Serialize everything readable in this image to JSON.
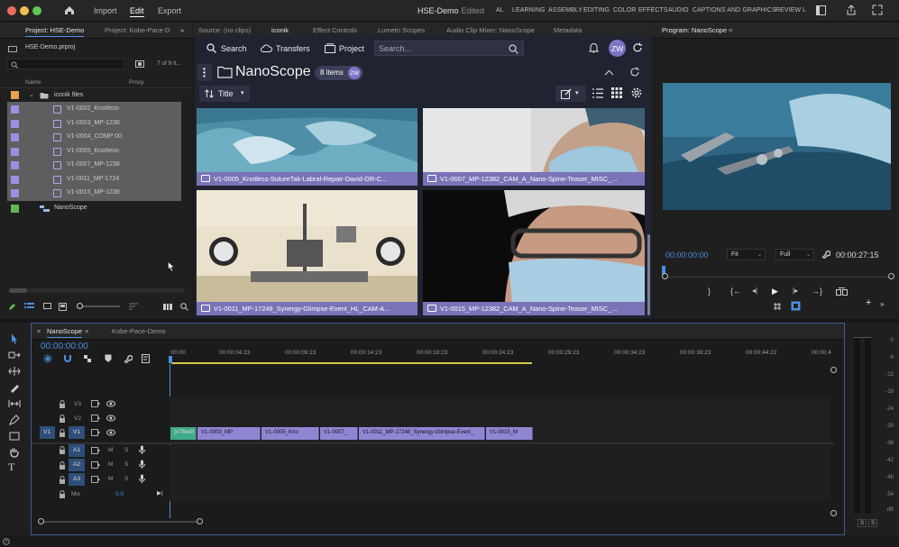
{
  "app": {
    "home_icon": "home-icon",
    "menu": [
      "Import",
      "Edit",
      "Export"
    ],
    "active_menu": "Edit",
    "doc_title": "HSE-Demo",
    "doc_state": "- Edited",
    "workspaces": [
      "AL",
      "LEARNING",
      "ASSEMBLY",
      "EDITING",
      "COLOR",
      "EFFECTS",
      "AUDIO",
      "CAPTIONS AND GRAPHICS",
      "REVIEW",
      "L"
    ]
  },
  "project_panel": {
    "tabs": [
      "Project: HSE-Demo",
      "Project: Kobe-Pace-D"
    ],
    "file": "HSE-Demo.prproj",
    "count": "7 of 9 it...",
    "columns": [
      "Name",
      "Proxy"
    ],
    "folder": "iconik files",
    "items": [
      "V1-0002_Knotless-",
      "V1-0003_MP-1238",
      "V1-0004_COMP 00",
      "V1-0005_Knotless-",
      "V1-0007_MP-1238",
      "V1-0011_MP-1724",
      "V1-0015_MP-1238"
    ],
    "sequence": "NanoScope"
  },
  "source_tabs": [
    "Source: (no clips)",
    "iconik",
    "Effect Controls",
    "Lumetri Scopes",
    "Audio Clip Mixer: NanoScope",
    "Metadata"
  ],
  "iconik": {
    "nav": [
      "Search",
      "Transfers",
      "Project"
    ],
    "search_placeholder": "Search...",
    "avatar": "ZW",
    "collection": "NanoScope",
    "items_badge": "8 items",
    "sort_label": "Title",
    "clips": [
      "V1-0005_Knotless-SutureTak-Labral-Repair-David-OR-C...",
      "V1-0007_MP-12382_CAM_A_Nano-Spine-Teaser_MISC_...",
      "V1-0011_MP-17248_Synergy-Glimpse-Event_HL_CAM-A...",
      "V1-0015_MP-12382_CAM_A_Nano-Spine-Teaser_MISC_..."
    ]
  },
  "program": {
    "tab": "Program: NanoScope",
    "timecode": "00:00:00:00",
    "fit": "Fit",
    "quality": "Full",
    "duration": "00:00:27:15"
  },
  "timeline": {
    "tabs": [
      "NanoScope",
      "Kobe-Pace-Demo"
    ],
    "timecode": "00:00:00:00",
    "ruler": [
      ":00:00",
      "00:00:04:23",
      "00:00:09:23",
      "00:00:14:23",
      "00:00:19:23",
      "00:00:24:23",
      "00:00:29:23",
      "00:00:34:23",
      "00:00:39:23",
      "00:00:44:22",
      "00:00:4"
    ],
    "video_tracks": [
      "V3",
      "V2",
      "V1"
    ],
    "audio_tracks": [
      "A1",
      "A2",
      "A3"
    ],
    "source_patch": "V1",
    "mix_label": "Mix",
    "mix_value": "0.0",
    "clips": [
      "{#7fbe0f",
      "V1-0003_MP",
      "V1-0005_Kno",
      "V1-0007_",
      "V1-0011_MP-17248_Synergy-Glimpse-Event_",
      "V1-0015_M"
    ]
  },
  "meter": {
    "ticks": [
      "0",
      "-6",
      "-12",
      "-18",
      "-24",
      "-30",
      "-36",
      "-42",
      "-48",
      "-54",
      "dB"
    ],
    "solo": [
      "S",
      "S"
    ]
  },
  "colors": {
    "accent": "#4a90e2",
    "clip": "#8f86d3",
    "iconik_bg": "#202330"
  }
}
